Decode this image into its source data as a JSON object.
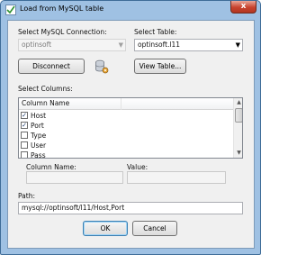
{
  "window": {
    "title": "Load from MySQL table",
    "close_glyph": "x"
  },
  "connection": {
    "label": "Select MySQL Connection:",
    "value": "optinsoft",
    "disconnect_label": "Disconnect",
    "db_icon": "database-gear-icon"
  },
  "table": {
    "label": "Select Table:",
    "value": "optinsoft.l11",
    "view_label": "View Table..."
  },
  "columns": {
    "label": "Select Columns:",
    "header": [
      "Column Name",
      ""
    ],
    "rows": [
      {
        "name": "Host",
        "checked": true
      },
      {
        "name": "Port",
        "checked": true
      },
      {
        "name": "Type",
        "checked": false
      },
      {
        "name": "User",
        "checked": false
      },
      {
        "name": "Pass",
        "checked": false
      }
    ]
  },
  "column_name": {
    "label": "Column Name:",
    "value": ""
  },
  "value_field": {
    "label": "Value:",
    "value": ""
  },
  "path": {
    "label": "Path:",
    "value": "mysql://optinsoft/l11/Host,Port"
  },
  "buttons": {
    "ok": "OK",
    "cancel": "Cancel"
  },
  "colors": {
    "frame": "#9fc1e3",
    "client": "#f0f0f0",
    "close": "#c8432e"
  }
}
